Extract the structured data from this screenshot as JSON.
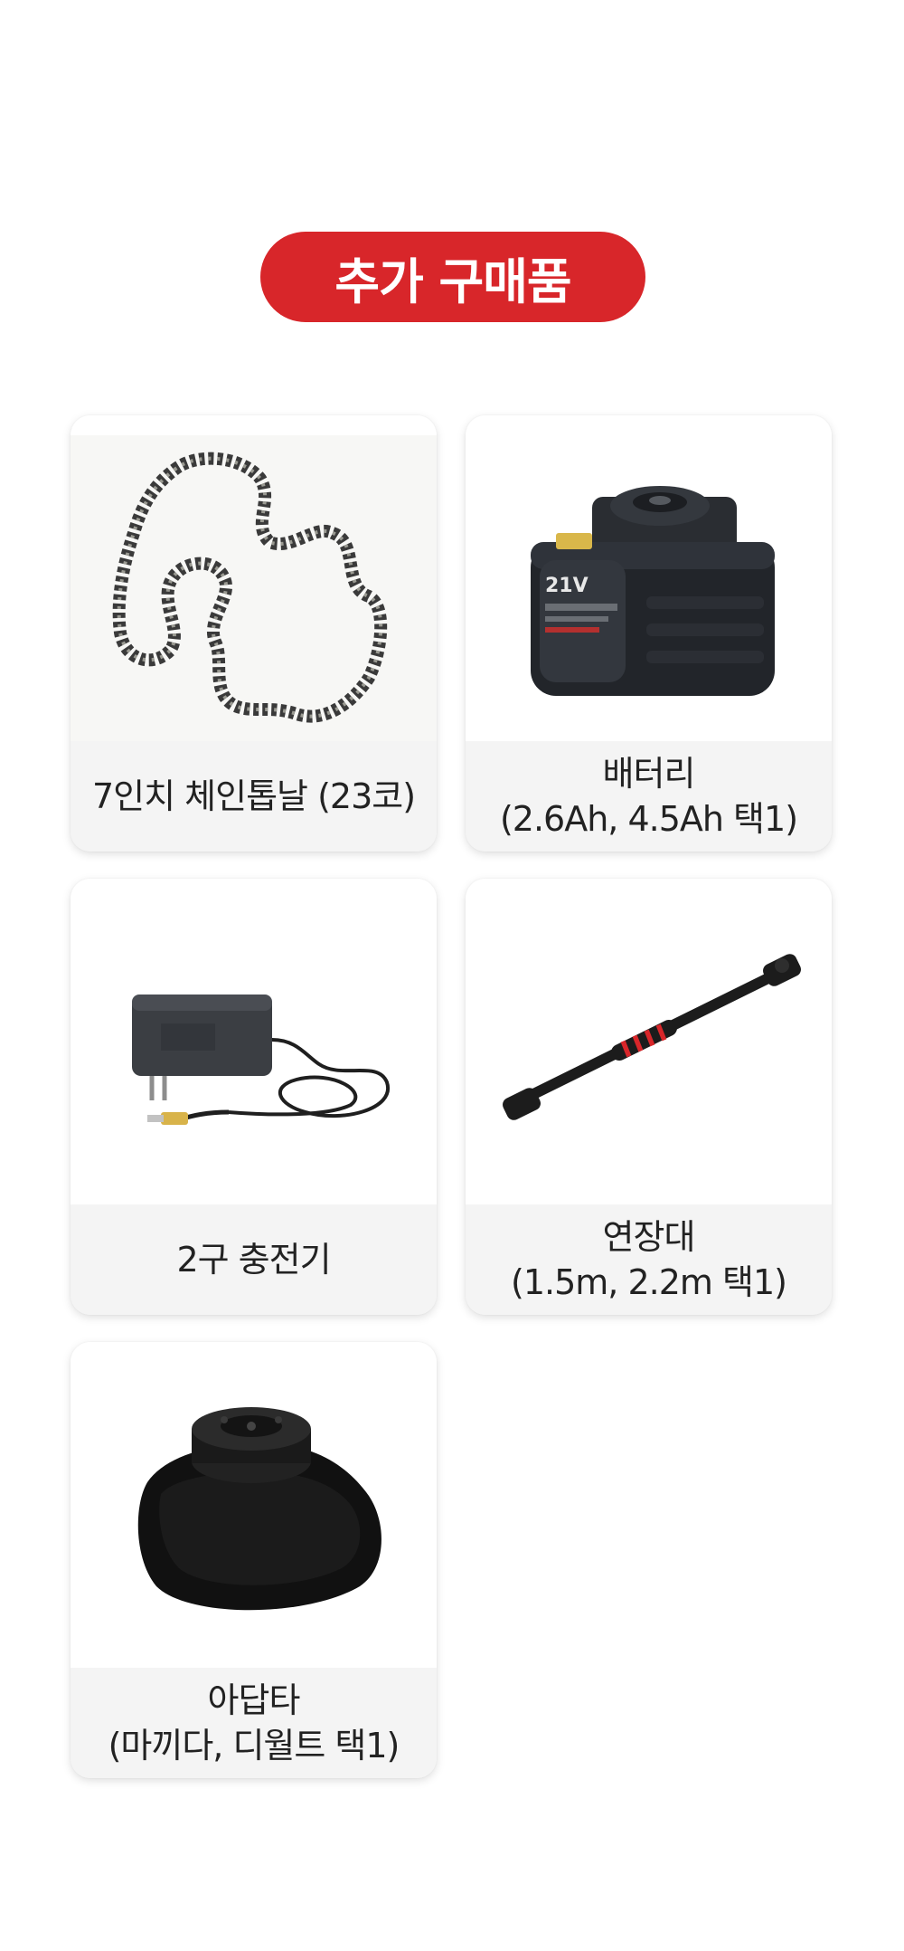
{
  "header": {
    "title": "추가 구매품",
    "accent_color": "#d8262a"
  },
  "products": [
    {
      "name": "7인치 체인톱날 (23코)",
      "detail": "",
      "image": "chain-icon"
    },
    {
      "name": "배터리",
      "detail": "(2.6Ah, 4.5Ah 택1)",
      "image": "battery-icon"
    },
    {
      "name": "2구 충전기",
      "detail": "",
      "image": "charger-icon"
    },
    {
      "name": "연장대",
      "detail": "(1.5m, 2.2m 택1)",
      "image": "extension-pole-icon"
    },
    {
      "name": "아답타",
      "detail": "(마끼다, 디월트 택1)",
      "image": "adapter-icon"
    }
  ]
}
